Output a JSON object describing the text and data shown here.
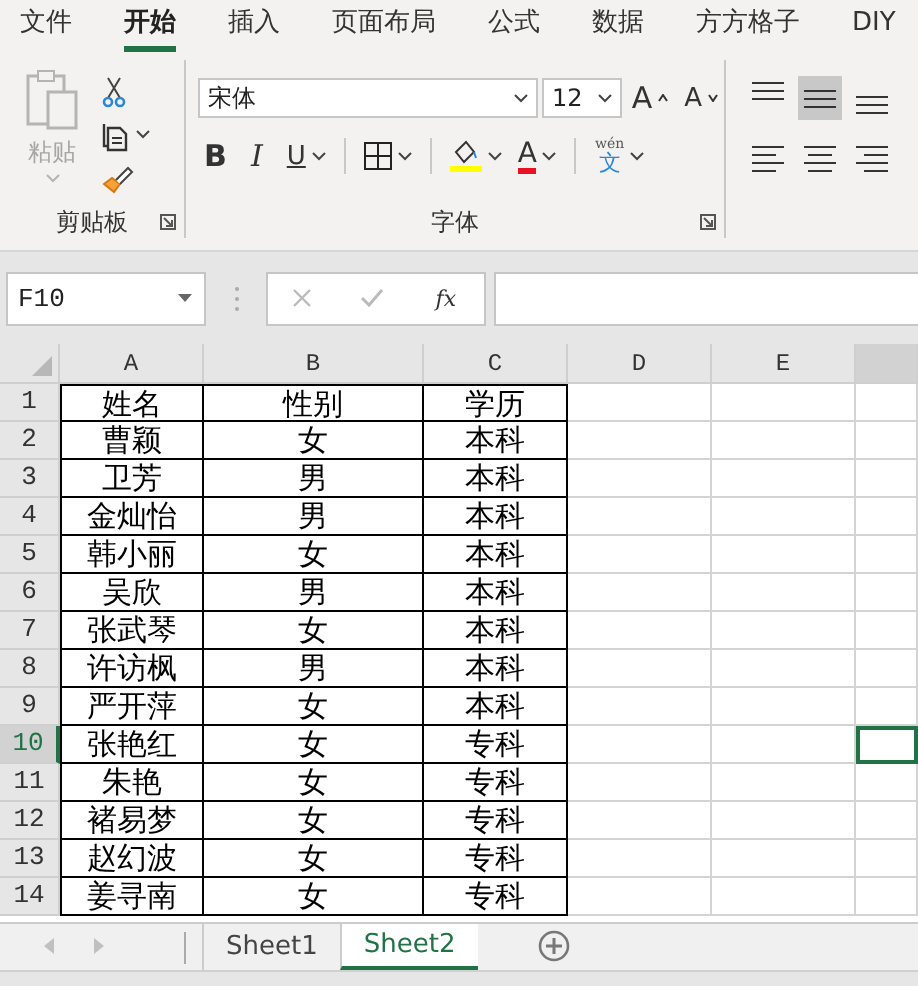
{
  "menu_tabs": [
    {
      "label": "文件",
      "selected": false
    },
    {
      "label": "开始",
      "selected": true
    },
    {
      "label": "插入",
      "selected": false
    },
    {
      "label": "页面布局",
      "selected": false
    },
    {
      "label": "公式",
      "selected": false
    },
    {
      "label": "数据",
      "selected": false
    },
    {
      "label": "方方格子",
      "selected": false
    },
    {
      "label": "DIY",
      "selected": false
    }
  ],
  "ribbon": {
    "clipboard": {
      "paste_label": "粘贴",
      "paste_disabled": true,
      "group_label": "剪贴板"
    },
    "font": {
      "font_name": "宋体",
      "font_size": "12",
      "grow_label": "A",
      "shrink_label": "A",
      "bold_label": "B",
      "italic_label": "I",
      "underline_label": "U",
      "font_color_label": "A",
      "phonetic_ruby": "wén",
      "phonetic_char": "文",
      "group_label": "字体"
    },
    "alignment": [
      {
        "kind": "top",
        "selected": false
      },
      {
        "kind": "middle",
        "selected": true
      },
      {
        "kind": "bottom",
        "selected": false
      },
      {
        "kind": "left",
        "selected": false
      },
      {
        "kind": "center",
        "selected": false
      },
      {
        "kind": "right",
        "selected": false
      }
    ]
  },
  "formula_bar": {
    "name_box": "F10",
    "fx_label": "fx"
  },
  "grid": {
    "columns": [
      "A",
      "B",
      "C",
      "D",
      "E"
    ],
    "last_column_selected": true,
    "rows": [
      {
        "number": "1",
        "selected": false,
        "cells": [
          "姓名",
          "性别",
          "学历"
        ]
      },
      {
        "number": "2",
        "selected": false,
        "cells": [
          "曹颖",
          "女",
          "本科"
        ]
      },
      {
        "number": "3",
        "selected": false,
        "cells": [
          "卫芳",
          "男",
          "本科"
        ]
      },
      {
        "number": "4",
        "selected": false,
        "cells": [
          "金灿怡",
          "男",
          "本科"
        ]
      },
      {
        "number": "5",
        "selected": false,
        "cells": [
          "韩小丽",
          "女",
          "本科"
        ]
      },
      {
        "number": "6",
        "selected": false,
        "cells": [
          "吴欣",
          "男",
          "本科"
        ]
      },
      {
        "number": "7",
        "selected": false,
        "cells": [
          "张武琴",
          "女",
          "本科"
        ]
      },
      {
        "number": "8",
        "selected": false,
        "cells": [
          "许访枫",
          "男",
          "本科"
        ]
      },
      {
        "number": "9",
        "selected": false,
        "cells": [
          "严开萍",
          "女",
          "本科"
        ]
      },
      {
        "number": "10",
        "selected": true,
        "cells": [
          "张艳红",
          "女",
          "专科"
        ]
      },
      {
        "number": "11",
        "selected": false,
        "cells": [
          "朱艳",
          "女",
          "专科"
        ]
      },
      {
        "number": "12",
        "selected": false,
        "cells": [
          "褚易梦",
          "女",
          "专科"
        ]
      },
      {
        "number": "13",
        "selected": false,
        "cells": [
          "赵幻波",
          "女",
          "专科"
        ]
      },
      {
        "number": "14",
        "selected": false,
        "cells": [
          "姜寻南",
          "女",
          "专科"
        ]
      }
    ]
  },
  "sheet_tabs": [
    {
      "label": "Sheet1",
      "selected": false
    },
    {
      "label": "Sheet2",
      "selected": true
    }
  ]
}
